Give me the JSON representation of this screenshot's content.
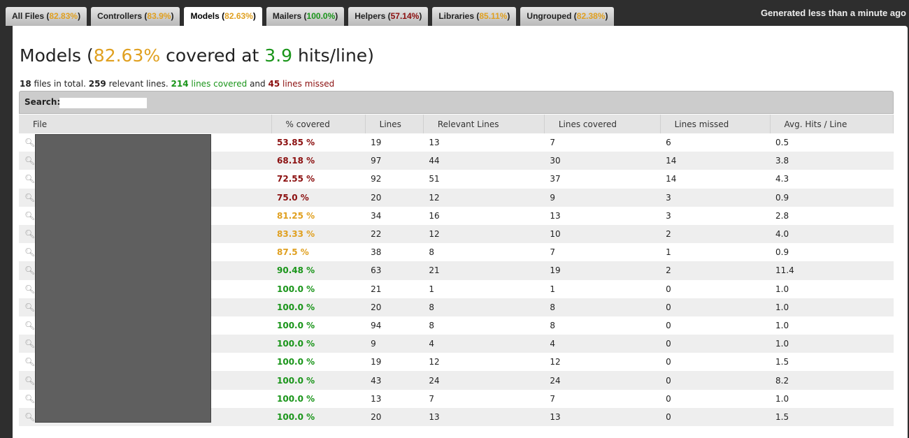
{
  "tabs": [
    {
      "name": "All Files",
      "pct": "82.83%",
      "color": "o"
    },
    {
      "name": "Controllers",
      "pct": "83.9%",
      "color": "o"
    },
    {
      "name": "Models",
      "pct": "82.63%",
      "color": "o",
      "active": true
    },
    {
      "name": "Mailers",
      "pct": "100.0%",
      "color": "g"
    },
    {
      "name": "Helpers",
      "pct": "57.14%",
      "color": "r"
    },
    {
      "name": "Libraries",
      "pct": "85.11%",
      "color": "o"
    },
    {
      "name": "Ungrouped",
      "pct": "82.38%",
      "color": "o"
    }
  ],
  "generated": "Generated less than a minute ago",
  "title": {
    "name": "Models",
    "pct": "82.63%",
    "mid": "covered at",
    "hits": "3.9",
    "end": "hits/line"
  },
  "summary": {
    "files": "18",
    "files_t": "files in total.",
    "relevant": "259",
    "relevant_t": "relevant lines.",
    "covered": "214",
    "covered_t": "lines covered",
    "and": "and",
    "missed": "45",
    "missed_t": "lines missed"
  },
  "search": {
    "label": "Search:",
    "value": ""
  },
  "columns": [
    "File",
    "% covered",
    "Lines",
    "Relevant Lines",
    "Lines covered",
    "Lines missed",
    "Avg. Hits / Line"
  ],
  "rows": [
    [
      "53.85 %",
      "19",
      "13",
      "7",
      "6",
      "0.5",
      "r"
    ],
    [
      "68.18 %",
      "97",
      "44",
      "30",
      "14",
      "3.8",
      "r"
    ],
    [
      "72.55 %",
      "92",
      "51",
      "37",
      "14",
      "4.3",
      "r"
    ],
    [
      "75.0 %",
      "20",
      "12",
      "9",
      "3",
      "0.9",
      "r"
    ],
    [
      "81.25 %",
      "34",
      "16",
      "13",
      "3",
      "2.8",
      "o"
    ],
    [
      "83.33 %",
      "22",
      "12",
      "10",
      "2",
      "4.0",
      "o"
    ],
    [
      "87.5 %",
      "38",
      "8",
      "7",
      "1",
      "0.9",
      "o"
    ],
    [
      "90.48 %",
      "63",
      "21",
      "19",
      "2",
      "11.4",
      "g"
    ],
    [
      "100.0 %",
      "21",
      "1",
      "1",
      "0",
      "1.0",
      "g"
    ],
    [
      "100.0 %",
      "20",
      "8",
      "8",
      "0",
      "1.0",
      "g"
    ],
    [
      "100.0 %",
      "94",
      "8",
      "8",
      "0",
      "1.0",
      "g"
    ],
    [
      "100.0 %",
      "9",
      "4",
      "4",
      "0",
      "1.0",
      "g"
    ],
    [
      "100.0 %",
      "19",
      "12",
      "12",
      "0",
      "1.5",
      "g"
    ],
    [
      "100.0 %",
      "43",
      "24",
      "24",
      "0",
      "8.2",
      "g"
    ],
    [
      "100.0 %",
      "13",
      "7",
      "7",
      "0",
      "1.0",
      "g"
    ],
    [
      "100.0 %",
      "20",
      "13",
      "13",
      "0",
      "1.5",
      "g"
    ]
  ]
}
